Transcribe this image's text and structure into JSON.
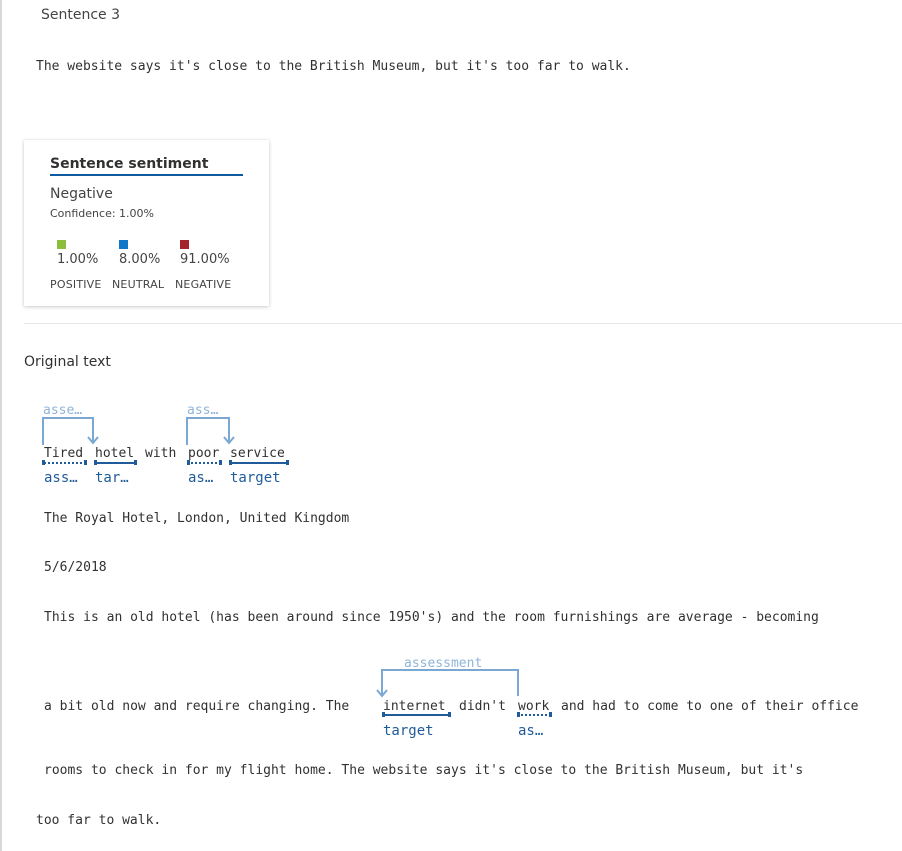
{
  "sentence": {
    "heading": "Sentence 3",
    "text": "The website says it's close to the British Museum, but it's too far to walk."
  },
  "sentiment_card": {
    "title": "Sentence sentiment",
    "label": "Negative",
    "confidence": "Confidence: 1.00%",
    "colors": {
      "positive": "#8cbd3b",
      "neutral": "#1277c9",
      "negative": "#a4262c"
    },
    "scores": [
      {
        "category": "POSITIVE",
        "percent": "1.00%"
      },
      {
        "category": "NEUTRAL",
        "percent": "8.00%"
      },
      {
        "category": "NEGATIVE",
        "percent": "91.00%"
      }
    ]
  },
  "original": {
    "heading": "Original text",
    "title_tokens": {
      "t1": "Tired",
      "t2": "hotel",
      "t3": "with",
      "t4": "poor",
      "t5": "service"
    },
    "title_roles": {
      "r1": "ass…",
      "r2": "tar…",
      "r4": "as…",
      "r5": "target"
    },
    "title_relations": {
      "rel1": "asse…",
      "rel2": "ass…"
    },
    "location": "The Royal Hotel, London, United Kingdom",
    "date": "5/6/2018",
    "body_line1": "This is an old hotel (has been around since 1950's) and the room furnishings are average - becoming",
    "body_line2": {
      "pre": "a bit old now and require changing. The",
      "target_word": "internet",
      "mid": "didn't",
      "assess_word": "work",
      "post": "and had to come to one of their office"
    },
    "body_line2_roles": {
      "target": "target",
      "assessment": "as…"
    },
    "body_line2_relation": "assessment",
    "body_line3": "rooms to check in for my flight home. The website says it's close to the British Museum, but it's",
    "body_line4": "too far to walk."
  }
}
